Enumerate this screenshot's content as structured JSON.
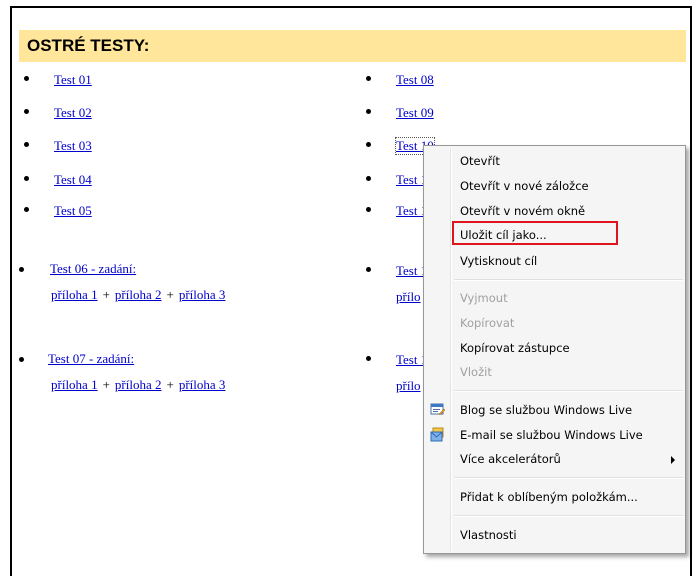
{
  "page": {
    "heading": "OSTRÉ TESTY:",
    "left_tests": [
      "Test 01",
      "Test 02",
      "Test 03",
      "Test 04",
      "Test 05"
    ],
    "right_tests": [
      "Test 08",
      "Test 09",
      "Test 10",
      "Test 11",
      "Test 12"
    ],
    "test06": {
      "title": "Test 06 -  zadání:",
      "attachments": [
        "příloha 1",
        "příloha 2",
        "příloha 3"
      ]
    },
    "test07": {
      "title": "Test 07 -  zadání:",
      "attachments": [
        "příloha 1",
        "příloha 2",
        "příloha 3"
      ]
    },
    "test13": {
      "title": "Test 13",
      "attachment_partial": "přílo"
    },
    "test14": {
      "title": "Test 14",
      "attachment_partial": "přílo"
    },
    "plus": "+"
  },
  "context_menu": {
    "items": [
      {
        "label": "Otevřít",
        "disabled": false
      },
      {
        "label": "Otevřít v nové záložce",
        "disabled": false
      },
      {
        "label": "Otevřít v novém okně",
        "disabled": false
      },
      {
        "label": "Uložit cíl jako...",
        "disabled": false,
        "highlighted": true
      },
      {
        "label": "Vytisknout cíl",
        "disabled": false
      },
      {
        "label": "Vyjmout",
        "disabled": true
      },
      {
        "label": "Kopírovat",
        "disabled": true
      },
      {
        "label": "Kopírovat zástupce",
        "disabled": false
      },
      {
        "label": "Vložit",
        "disabled": true
      },
      {
        "label": "Blog se službou Windows Live",
        "disabled": false,
        "icon": "blog-icon"
      },
      {
        "label": "E-mail se službou Windows Live",
        "disabled": false,
        "icon": "email-icon"
      },
      {
        "label": "Více akcelerátorů",
        "disabled": false,
        "submenu": true
      },
      {
        "label": "Přidat k oblíbeným položkám...",
        "disabled": false
      },
      {
        "label": "Vlastnosti",
        "disabled": false
      }
    ],
    "highlight_color": "#e0141e"
  }
}
